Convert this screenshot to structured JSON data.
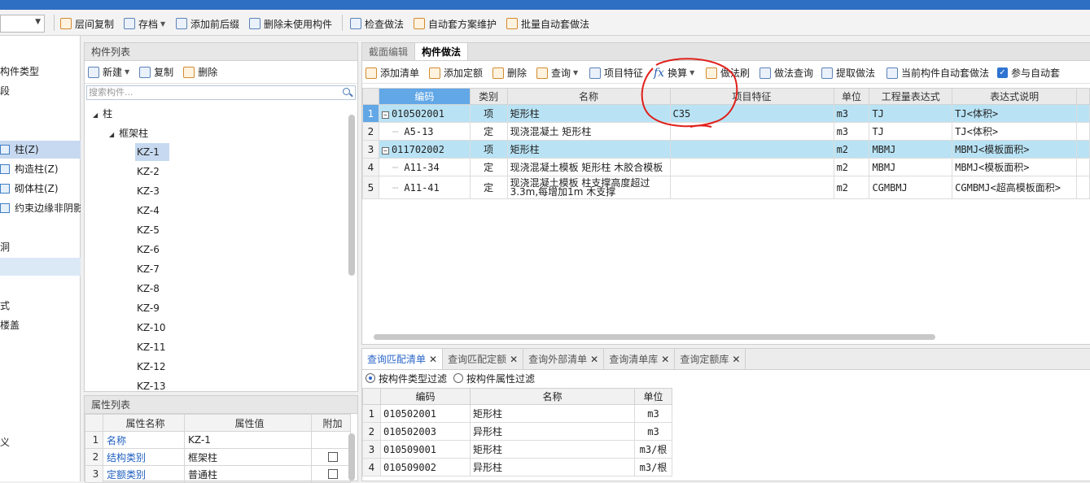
{
  "toolbar": {
    "combo_value": "",
    "buttons": [
      "层间复制",
      "存档",
      "添加前后缀",
      "删除未使用构件",
      "检查做法",
      "自动套方案维护",
      "批量自动套做法"
    ]
  },
  "left_nav": {
    "items": [
      "构件类型",
      "段",
      "",
      "柱(Z)",
      "构造柱(Z)",
      "砌体柱(Z)",
      "约束边缘非阴影",
      "洞",
      "式",
      "楼盖",
      "义"
    ]
  },
  "component_list": {
    "header": "构件列表",
    "tools": {
      "new": "新建",
      "copy": "复制",
      "delete": "删除"
    },
    "search_placeholder": "搜索构件...",
    "tree_root": "柱",
    "tree_child": "框架柱",
    "items": [
      "KZ-1",
      "KZ-2",
      "KZ-3",
      "KZ-4",
      "KZ-5",
      "KZ-6",
      "KZ-7",
      "KZ-8",
      "KZ-9",
      "KZ-10",
      "KZ-11",
      "KZ-12",
      "KZ-13"
    ]
  },
  "property_list": {
    "header": "属性列表",
    "columns": [
      "属性名称",
      "属性值",
      "附加"
    ],
    "rows": [
      {
        "n": "1",
        "name": "名称",
        "value": "KZ-1"
      },
      {
        "n": "2",
        "name": "结构类别",
        "value": "框架柱"
      },
      {
        "n": "3",
        "name": "定额类别",
        "value": "普通柱"
      }
    ]
  },
  "main": {
    "tabs": [
      "截面编辑",
      "构件做法"
    ],
    "tools": {
      "add_list": "添加清单",
      "add_quota": "添加定额",
      "delete": "删除",
      "query": "查询",
      "item_feature": "项目特征",
      "convert": "换算",
      "brush": "做法刷",
      "method_query": "做法查询",
      "extract": "提取做法",
      "auto_current": "当前构件自动套做法",
      "participate": "参与自动套"
    },
    "columns": [
      "编码",
      "类别",
      "名称",
      "项目特征",
      "单位",
      "工程量表达式",
      "表达式说明"
    ],
    "rows": [
      {
        "n": "1",
        "code": "010502001",
        "type": "项",
        "name": "矩形柱",
        "feature": "C35",
        "unit": "m3",
        "expr": "TJ",
        "desc": "TJ<体积>"
      },
      {
        "n": "2",
        "code": "A5-13",
        "type": "定",
        "name": "现浇混凝土 矩形柱",
        "feature": "",
        "unit": "m3",
        "expr": "TJ",
        "desc": "TJ<体积>"
      },
      {
        "n": "3",
        "code": "011702002",
        "type": "项",
        "name": "矩形柱",
        "feature": "",
        "unit": "m2",
        "expr": "MBMJ",
        "desc": "MBMJ<模板面积>"
      },
      {
        "n": "4",
        "code": "A11-34",
        "type": "定",
        "name": "现浇混凝土模板 矩形柱 木胶合模板",
        "feature": "",
        "unit": "m2",
        "expr": "MBMJ",
        "desc": "MBMJ<模板面积>"
      },
      {
        "n": "5",
        "code": "A11-41",
        "type": "定",
        "name": "现浇混凝土模板 柱支撑高度超过3.3m,每增加1m 木支撑",
        "feature": "",
        "unit": "m2",
        "expr": "CGMBMJ",
        "desc": "CGMBMJ<超高模板面积>"
      }
    ]
  },
  "bottom": {
    "tabs": [
      "查询匹配清单",
      "查询匹配定额",
      "查询外部清单",
      "查询清单库",
      "查询定额库"
    ],
    "filter_type": "按构件类型过滤",
    "filter_attr": "按构件属性过滤",
    "columns": [
      "编码",
      "名称",
      "单位"
    ],
    "rows": [
      {
        "n": "1",
        "code": "010502001",
        "name": "矩形柱",
        "unit": "m3"
      },
      {
        "n": "2",
        "code": "010502003",
        "name": "异形柱",
        "unit": "m3"
      },
      {
        "n": "3",
        "code": "010509001",
        "name": "矩形柱",
        "unit": "m3/根"
      },
      {
        "n": "4",
        "code": "010509002",
        "name": "异形柱",
        "unit": "m3/根"
      }
    ]
  },
  "colors": {
    "title_bar": "#2f6fc3",
    "selection": "#62a7e6",
    "row_highlight": "#b9e3f5",
    "annotation": "#e0201b"
  }
}
